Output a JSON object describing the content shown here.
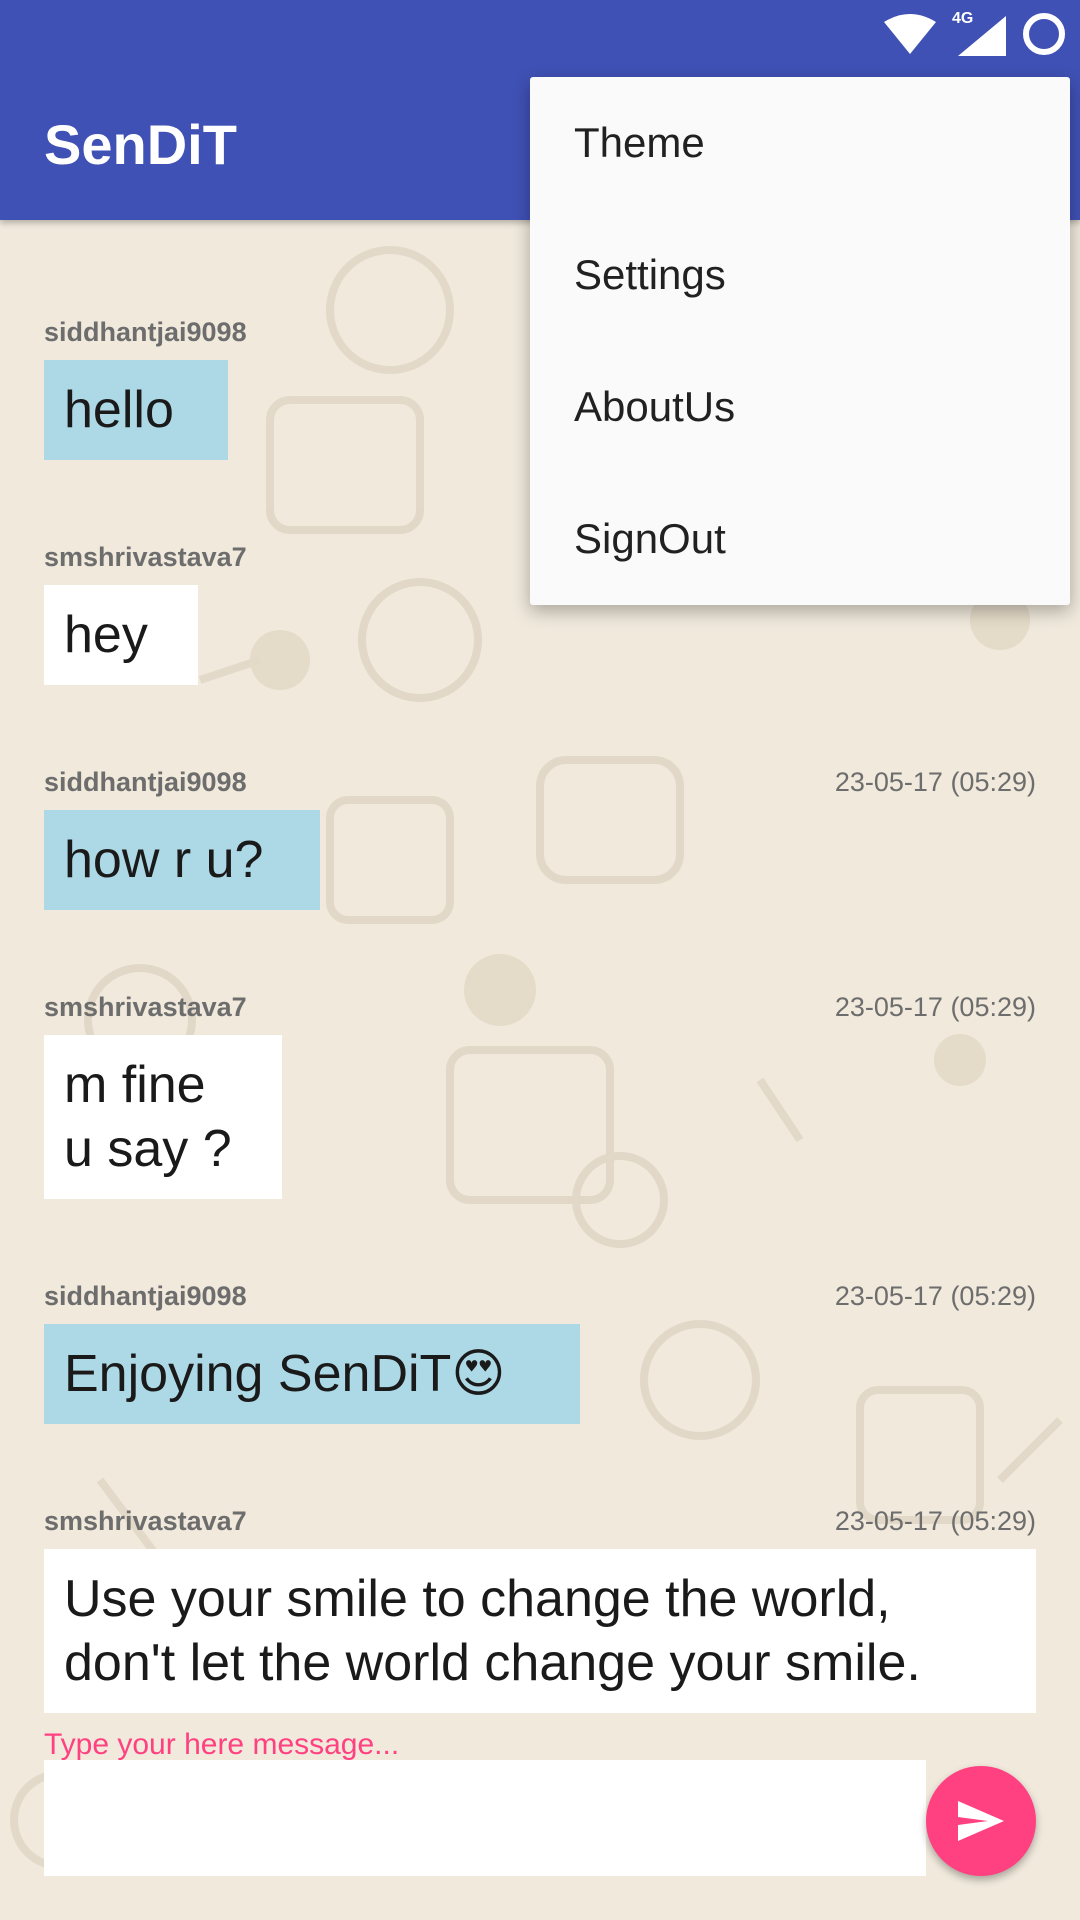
{
  "status_bar": {
    "network_label": "4G",
    "icons": [
      "wifi-icon",
      "cell-signal-icon",
      "circle-home-icon"
    ]
  },
  "appbar": {
    "title": "SenDiT"
  },
  "menu": {
    "items": [
      {
        "label": "Theme"
      },
      {
        "label": "Settings"
      },
      {
        "label": "AboutUs"
      },
      {
        "label": "SignOut"
      }
    ]
  },
  "messages": [
    {
      "sender": "siddhantjai9098",
      "time": "",
      "text": "hello",
      "style": "blue"
    },
    {
      "sender": "smshrivastava7",
      "time": "",
      "text": "hey",
      "style": "white"
    },
    {
      "sender": "siddhantjai9098",
      "time": "23-05-17 (05:29)",
      "text": "how r u?",
      "style": "blue"
    },
    {
      "sender": "smshrivastava7",
      "time": "23-05-17 (05:29)",
      "text": "m fine\nu say ?",
      "style": "white"
    },
    {
      "sender": "siddhantjai9098",
      "time": "23-05-17 (05:29)",
      "text": "Enjoying SenDiT😍",
      "style": "blue"
    },
    {
      "sender": "smshrivastava7",
      "time": "23-05-17 (05:29)",
      "text": "Use your smile to change the world,\ndon't let the world change your smile.",
      "style": "white"
    }
  ],
  "composer": {
    "hint": "Type your here message...",
    "value": "",
    "send_icon": "send-icon"
  },
  "colors": {
    "primary": "#3f51b5",
    "accent": "#ff4081",
    "bubble_blue": "#add8e6",
    "bubble_white": "#ffffff"
  }
}
